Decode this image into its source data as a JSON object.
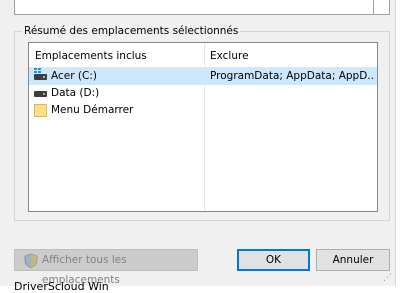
{
  "group": {
    "title": "Résumé des emplacements sélectionnés"
  },
  "list": {
    "columns": [
      "Emplacements inclus",
      "Exclure"
    ],
    "rows": [
      {
        "name": "Acer (C:)",
        "exclude": "ProgramData; AppData; AppD...",
        "icon": "windows-drive-icon",
        "selected": true
      },
      {
        "name": "Data (D:)",
        "exclude": "",
        "icon": "drive-icon",
        "selected": false
      },
      {
        "name": "Menu Démarrer",
        "exclude": "",
        "icon": "folder-icon",
        "selected": false
      }
    ]
  },
  "buttons": {
    "show_all": "Afficher tous les emplacements",
    "ok": "OK",
    "cancel": "Annuler"
  },
  "footer": {
    "text": "DriverScloud Win"
  },
  "colors": {
    "selection": "#cce8ff",
    "default_button_border": "#0078d7"
  }
}
